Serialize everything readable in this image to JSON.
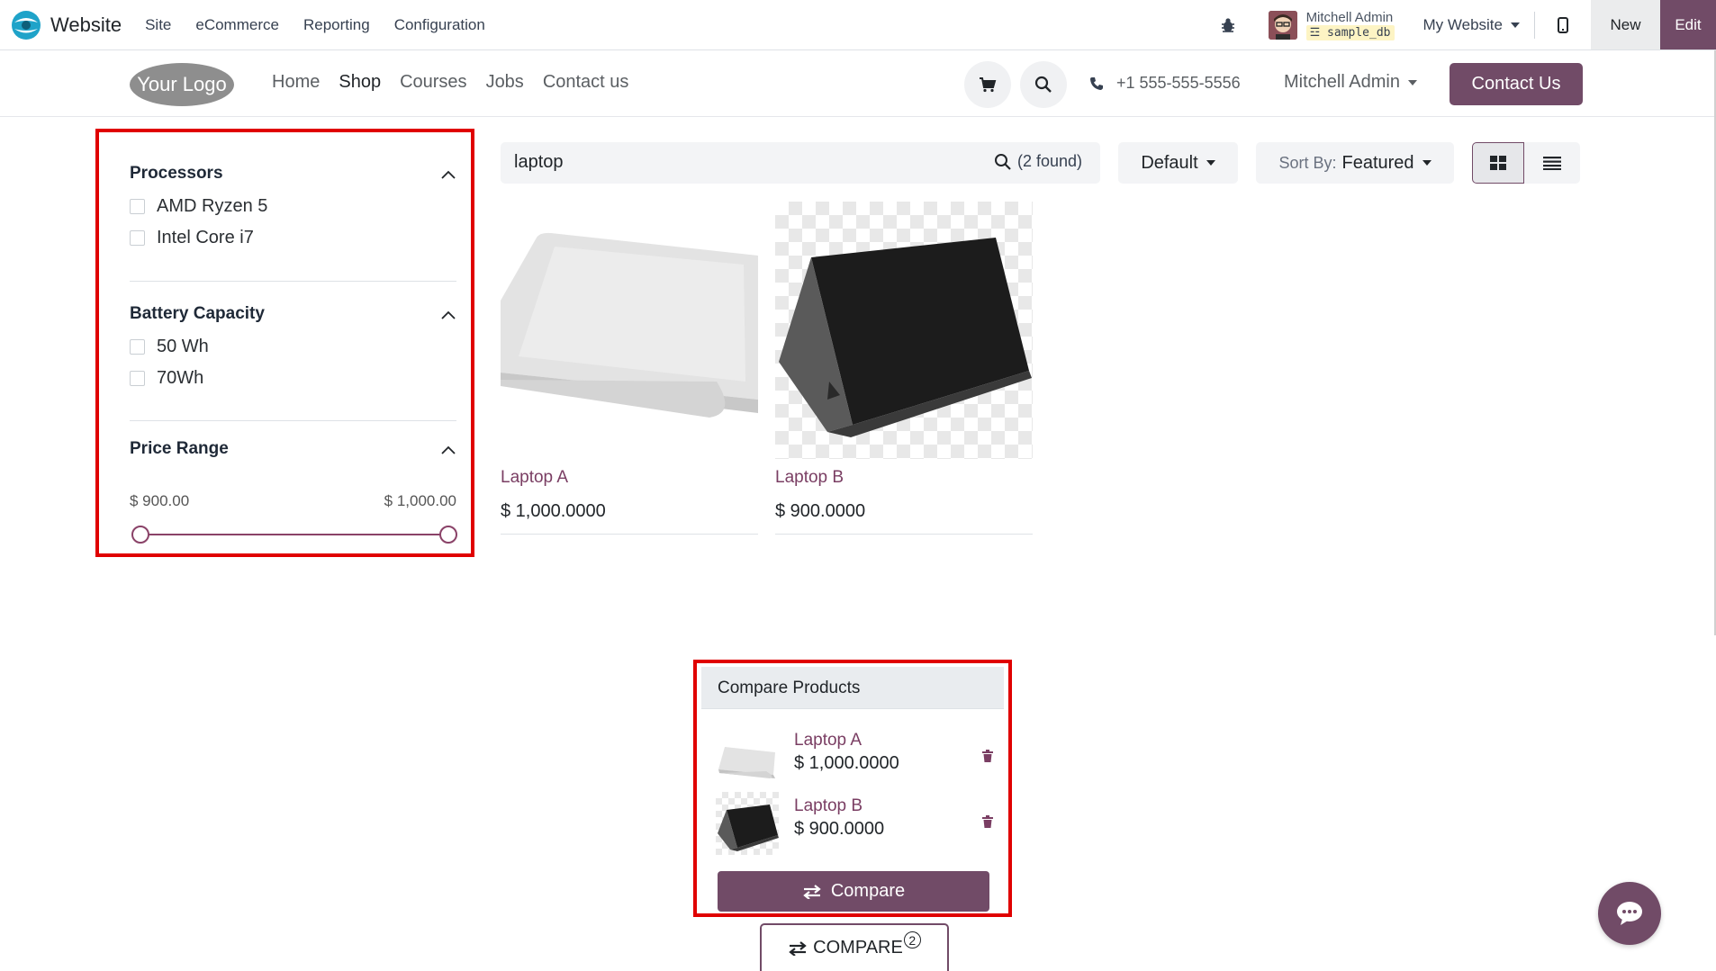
{
  "topbar": {
    "app_name": "Website",
    "menu": [
      "Site",
      "eCommerce",
      "Reporting",
      "Configuration"
    ],
    "user_name": "Mitchell Admin",
    "db_name": "sample_db",
    "website_select": "My Website",
    "new_label": "New",
    "edit_label": "Edit"
  },
  "header": {
    "logo_text": "Your Logo",
    "nav": [
      "Home",
      "Shop",
      "Courses",
      "Jobs",
      "Contact us"
    ],
    "active_nav": "Shop",
    "phone": "+1 555-555-5556",
    "user": "Mitchell Admin",
    "contact_button": "Contact Us"
  },
  "filters": {
    "processors": {
      "title": "Processors",
      "options": [
        "AMD Ryzen 5",
        "Intel Core i7"
      ]
    },
    "battery": {
      "title": "Battery Capacity",
      "options": [
        "50 Wh",
        "70Wh"
      ]
    },
    "price": {
      "title": "Price Range",
      "min_label": "$ 900.00",
      "max_label": "$ 1,000.00"
    }
  },
  "search": {
    "query": "laptop",
    "found": "(2 found)",
    "pricelist": "Default",
    "sort_prefix": "Sort By:",
    "sort_value": "Featured"
  },
  "products": [
    {
      "name": "Laptop A",
      "price": "$ 1,000.0000"
    },
    {
      "name": "Laptop B",
      "price": "$ 900.0000"
    }
  ],
  "compare": {
    "title": "Compare Products",
    "items": [
      {
        "name": "Laptop A",
        "price": "$ 1,000.0000"
      },
      {
        "name": "Laptop B",
        "price": "$ 900.0000"
      }
    ],
    "button": "Compare",
    "tab_label": "COMPARE",
    "tab_count": "2"
  },
  "colors": {
    "brand": "#714b67",
    "highlight": "#e00000",
    "product_link": "#7a3e63"
  }
}
